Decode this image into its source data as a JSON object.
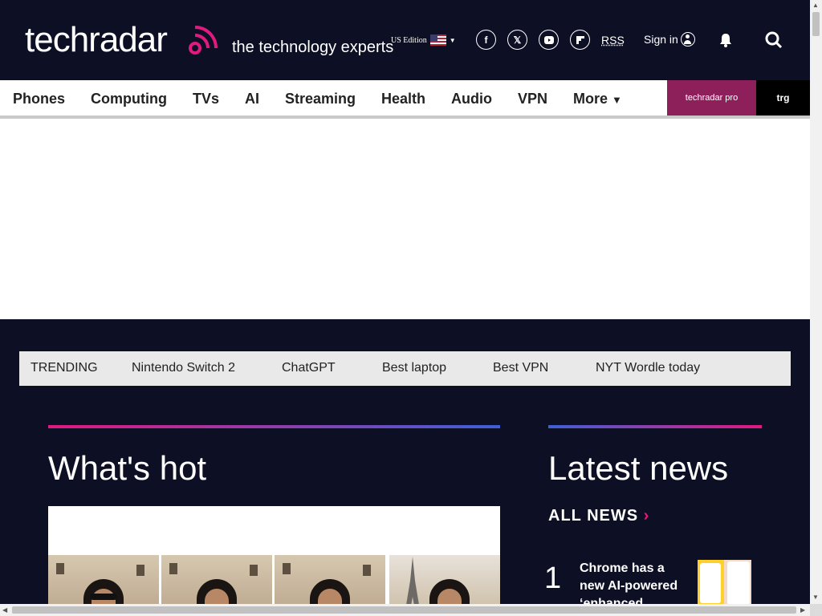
{
  "header": {
    "logo_text": "techradar",
    "tagline": "the technology experts",
    "edition": "US Edition",
    "rss": "RSS",
    "signin": "Sign in"
  },
  "nav": {
    "items": [
      "Phones",
      "Computing",
      "TVs",
      "AI",
      "Streaming",
      "Health",
      "Audio",
      "VPN",
      "More"
    ],
    "pro_label": "techradar pro",
    "trg_label": "trg"
  },
  "trending": {
    "label": "TRENDING",
    "items": [
      "Nintendo Switch 2",
      "ChatGPT",
      "Best laptop",
      "Best VPN",
      "NYT Wordle today"
    ]
  },
  "whats_hot": {
    "title": "What's hot"
  },
  "latest_news": {
    "title": "Latest news",
    "all_news": "ALL NEWS",
    "items": [
      {
        "rank": "1",
        "headline": "Chrome has a new AI-powered ‘enhanced"
      }
    ]
  },
  "colors": {
    "brand_pink": "#e2197f",
    "background": "#0d1024",
    "pro": "#8d1f5b"
  },
  "icons": [
    "facebook-icon",
    "x-icon",
    "youtube-icon",
    "flipboard-icon",
    "user-icon",
    "bell-icon",
    "search-icon"
  ]
}
